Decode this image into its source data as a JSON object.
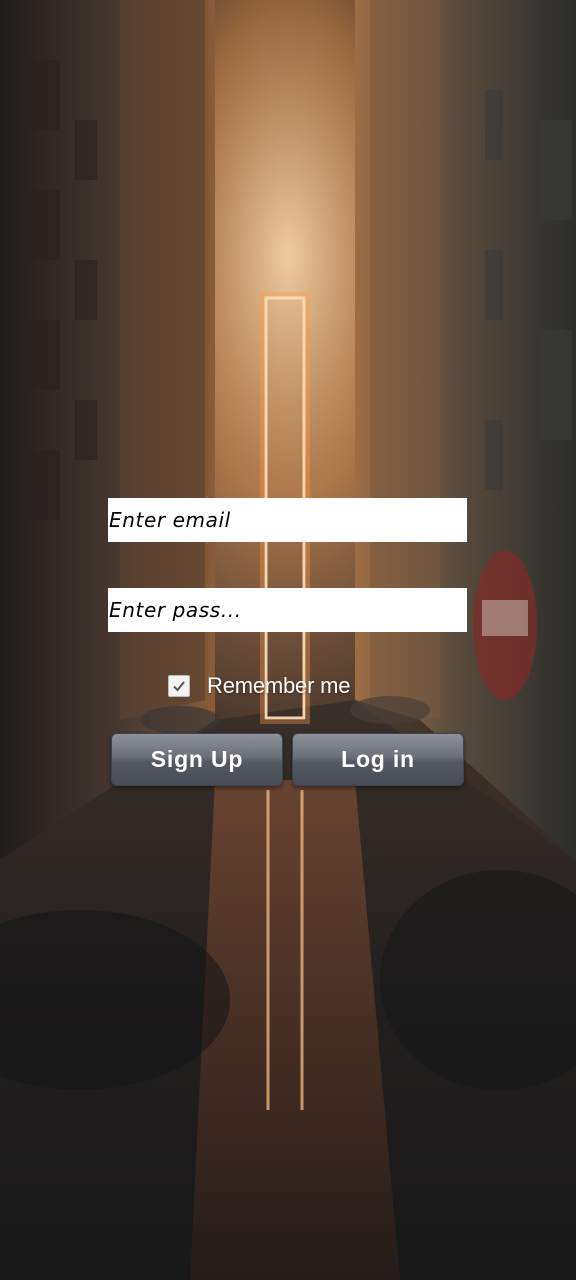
{
  "login_form": {
    "email_placeholder": "Enter email",
    "password_placeholder": "Enter pass...",
    "remember_label": "Remember me",
    "remember_checked": true,
    "signup_label": "Sign Up",
    "login_label": "Log in"
  },
  "background": {
    "description_icon": "city-alley-background"
  },
  "colors": {
    "field_background": "#ffffff",
    "button_gradient_top": "#8d929c",
    "button_gradient_bottom": "#474c56",
    "label_text": "#ffffff"
  }
}
